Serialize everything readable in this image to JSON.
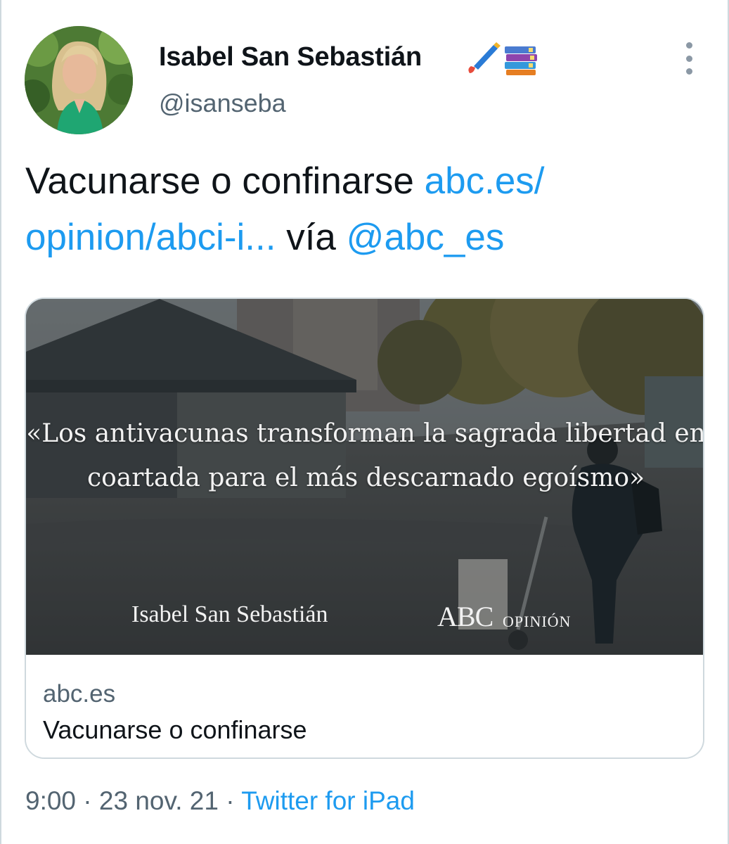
{
  "tweet": {
    "author": {
      "name": "Isabel San Sebastián",
      "name_emoji": [
        "paintbrush-emoji",
        "books-emoji"
      ],
      "handle": "@isanseba"
    },
    "text": {
      "plain": "Vacunarse o confinarse ",
      "link": "abc.es/ opinion/abci-i...",
      "via": " vía ",
      "mention": "@abc_es"
    },
    "card": {
      "quote": "«Los antivacunas transforman la sagrada libertad en coartada para el más descarnado egoísmo»",
      "quote_author": "Isabel San Sebastián",
      "brand": "ABC",
      "brand_sub": "OPINIÓN",
      "domain": "abc.es",
      "title": "Vacunarse o confinarse"
    },
    "meta": {
      "time": "9:00",
      "sep1": " · ",
      "date": "23 nov. 21",
      "sep2": " · ",
      "source": "Twitter for iPad"
    }
  },
  "colors": {
    "link": "#1d9bf0",
    "text": "#0f1419",
    "secondary": "#536471",
    "border": "#cfd9de"
  },
  "icons": {
    "more": "more-vertical-icon"
  }
}
